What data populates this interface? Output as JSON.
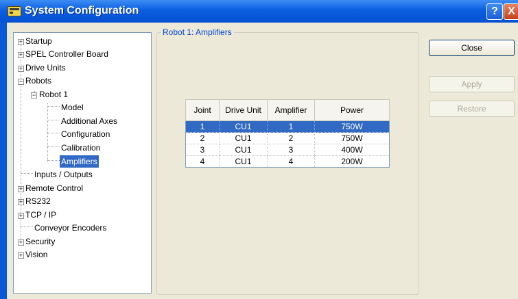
{
  "window": {
    "title": "System Configuration"
  },
  "titlebar": {
    "help_glyph": "?",
    "close_glyph": "X"
  },
  "tree": {
    "items": [
      {
        "label": "Startup",
        "expander": "+"
      },
      {
        "label": "SPEL Controller Board",
        "expander": "+"
      },
      {
        "label": "Drive Units",
        "expander": "+"
      },
      {
        "label": "Robots",
        "expander": "−"
      },
      {
        "label": "Robot 1",
        "expander": "−"
      },
      {
        "label": "Model"
      },
      {
        "label": "Additional Axes"
      },
      {
        "label": "Configuration"
      },
      {
        "label": "Calibration"
      },
      {
        "label": "Amplifiers",
        "selected": true
      },
      {
        "label": "Inputs / Outputs"
      },
      {
        "label": "Remote Control",
        "expander": "+"
      },
      {
        "label": "RS232",
        "expander": "+"
      },
      {
        "label": "TCP / IP",
        "expander": "+"
      },
      {
        "label": "Conveyor Encoders"
      },
      {
        "label": "Security",
        "expander": "+"
      },
      {
        "label": "Vision",
        "expander": "+"
      }
    ]
  },
  "panel": {
    "group_title": "Robot 1: Amplifiers"
  },
  "table": {
    "headers": [
      "Joint",
      "Drive Unit",
      "Amplifier",
      "Power"
    ],
    "rows": [
      [
        "1",
        "CU1",
        "1",
        "750W"
      ],
      [
        "2",
        "CU1",
        "2",
        "750W"
      ],
      [
        "3",
        "CU1",
        "3",
        "400W"
      ],
      [
        "4",
        "CU1",
        "4",
        "200W"
      ]
    ],
    "selected_row": 0
  },
  "buttons": {
    "close": "Close",
    "apply": "Apply",
    "restore": "Restore"
  },
  "colors": {
    "selection": "#316AC5",
    "title_bar": "#0A58D8",
    "group_title": "#0046D5"
  }
}
